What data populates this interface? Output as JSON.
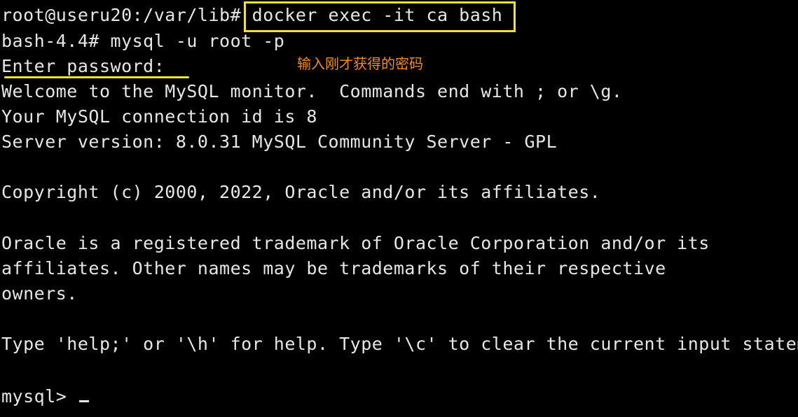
{
  "terminal": {
    "lines": [
      "root@useru20:/var/lib# docker exec -it ca bash",
      "bash-4.4# mysql -u root -p",
      "Enter password:",
      "Welcome to the MySQL monitor.  Commands end with ; or \\g.",
      "Your MySQL connection id is 8",
      "Server version: 8.0.31 MySQL Community Server - GPL",
      "Copyright (c) 2000, 2022, Oracle and/or its affiliates.",
      "Oracle is a registered trademark of Oracle Corporation and/or its",
      "affiliates. Other names may be trademarks of their respective",
      "owners.",
      "Type 'help;' or '\\h' for help. Type '\\c' to clear the current input statem"
    ],
    "prompt": "mysql> "
  },
  "annotation": {
    "note": "输入刚才获得的密码",
    "note_color": "#f08a24",
    "highlight_color": "#f0e03c"
  },
  "colors": {
    "background": "#000000",
    "text": "#e6e6e6"
  }
}
